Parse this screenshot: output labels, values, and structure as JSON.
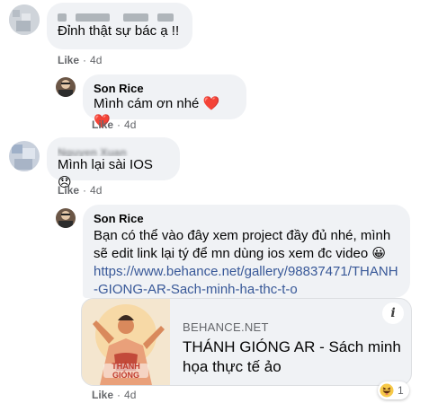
{
  "comments": [
    {
      "text": "Đỉnh thật sự bác ạ !!",
      "like_label": "Like",
      "time": "4d"
    },
    {
      "author": "Son Rice",
      "text": "Mình cám ơn nhé ❤️ ❤️",
      "like_label": "Like",
      "time": "4d"
    },
    {
      "author_partial": "Nguyen Xuan",
      "text": "Mình lại sài IOS 😞",
      "like_label": "Like",
      "time": "4d"
    },
    {
      "author": "Son Rice",
      "text": "Bạn có thể vào đây xem project đầy đủ nhé, mình sẽ edit link lại tý để mn dùng ios xem đc video 😀",
      "link": "https://www.behance.net/gallery/98837471/THANH-GIONG-AR-Sach-minh-ha-thc-t-o",
      "preview": {
        "domain": "BEHANCE.NET",
        "title": "THÁNH GIÓNG AR - Sách minh họa thực tế ảo",
        "image_caption": "THÁNH GIÓNG",
        "info_icon": "i"
      },
      "reaction": {
        "icon": "haha-emoji",
        "count": "1"
      },
      "like_label": "Like",
      "time": "4d"
    }
  ],
  "separator": "·"
}
